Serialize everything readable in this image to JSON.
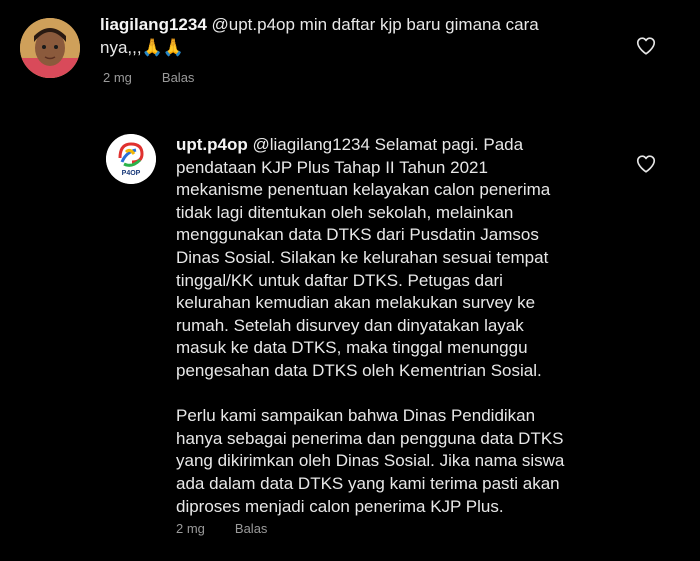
{
  "comments": [
    {
      "username": "liagilang1234",
      "text": "@upt.p4op min daftar kjp baru gimana cara\nnya,,,🙏🙏",
      "time": "2 mg",
      "reply_label": "Balas"
    },
    {
      "username": "upt.p4op",
      "text": "@liagilang1234 Selamat pagi. Pada\npendataan KJP Plus Tahap II Tahun 2021\nmekanisme penentuan kelayakan calon penerima\ntidak lagi ditentukan oleh sekolah, melainkan\nmenggunakan data DTKS dari Pusdatin Jamsos\nDinas Sosial. Silakan ke kelurahan sesuai tempat\ntinggal/KK untuk daftar DTKS. Petugas dari\nkelurahan kemudian akan melakukan survey ke\nrumah. Setelah disurvey dan dinyatakan layak\nmasuk ke data DTKS, maka tinggal menunggu\npengesahan data DTKS oleh Kementrian Sosial.\n\nPerlu kami sampaikan bahwa Dinas Pendidikan\nhanya sebagai penerima dan pengguna data DTKS\nyang dikirimkan oleh Dinas Sosial. Jika nama siswa\nada dalam data DTKS yang kami terima pasti akan\ndiproses menjadi calon penerima KJP Plus.",
      "time": "2 mg",
      "reply_label": "Balas",
      "avatar_logo_text": "P4OP"
    }
  ],
  "colors": {
    "background": "#000000",
    "text": "#e8e8e8",
    "meta": "#9a9a9a"
  },
  "icons": [
    "heart-outline-icon",
    "user-avatar",
    "p4op-logo-avatar"
  ]
}
